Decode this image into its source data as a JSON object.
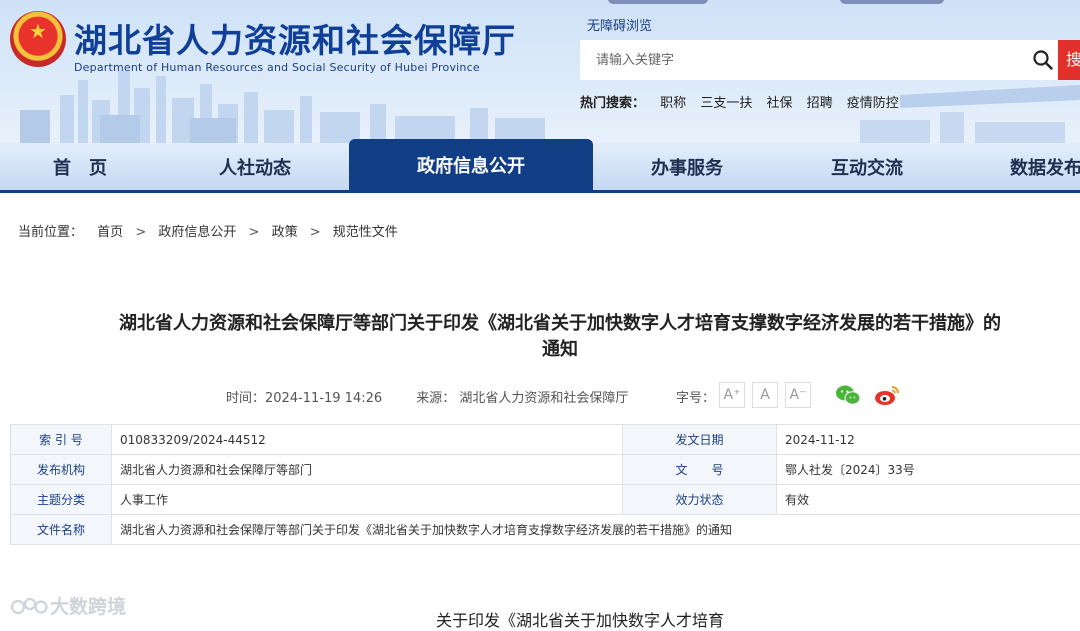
{
  "header": {
    "title": "湖北省人力资源和社会保障厅",
    "subtitle": "Department of Human Resources and Social Security of Hubei Province",
    "accessible_link": "无障碍浏览",
    "search_placeholder": "请输入关键字",
    "search_button": "搜",
    "hot_search_label": "热门搜索：",
    "hot_search_items": [
      "职称",
      "三支一扶",
      "社保",
      "招聘",
      "疫情防控"
    ]
  },
  "nav": {
    "items": [
      "首　页",
      "人社动态",
      "政府信息公开",
      "办事服务",
      "互动交流",
      "数据发布"
    ],
    "active": "政府信息公开"
  },
  "breadcrumb": {
    "label": "当前位置：",
    "items": [
      "首页",
      "政府信息公开",
      "政策",
      "规范性文件"
    ],
    "separator": ">"
  },
  "article": {
    "title_line1": "湖北省人力资源和社会保障厅等部门关于印发《湖北省关于加快数字人才培育支撑数字经济发展的若干措施》的",
    "title_line2": "通知",
    "time": "时间：2024-11-19 14:26",
    "source": "来源：  湖北省人力资源和社会保障厅",
    "font_size_label": "字号：",
    "font_size_buttons": [
      "A⁺",
      "A",
      "A⁻"
    ]
  },
  "info_table": {
    "index_label": "索 引 号",
    "index_value": "010833209/2024-44512",
    "issue_date_label": "发文日期",
    "issue_date_value": "2024-11-12",
    "publisher_label": "发布机构",
    "publisher_value": "湖北省人力资源和社会保障厅等部门",
    "doc_no_label": "文　　号",
    "doc_no_value": "鄂人社发〔2024〕33号",
    "category_label": "主题分类",
    "category_value": "人事工作",
    "status_label": "效力状态",
    "status_value": "有效",
    "filename_label": "文件名称",
    "filename_value": "湖北省人力资源和社会保障厅等部门关于印发《湖北省关于加快数字人才培育支撑数字经济发展的若干措施》的通知"
  },
  "body_start": "关于印发《湖北省关于加快数字人才培育",
  "watermark": "大数跨境",
  "colors": {
    "nav_active": "#123e86",
    "search_button": "#e2312d",
    "title_blue": "#0f3f97"
  }
}
